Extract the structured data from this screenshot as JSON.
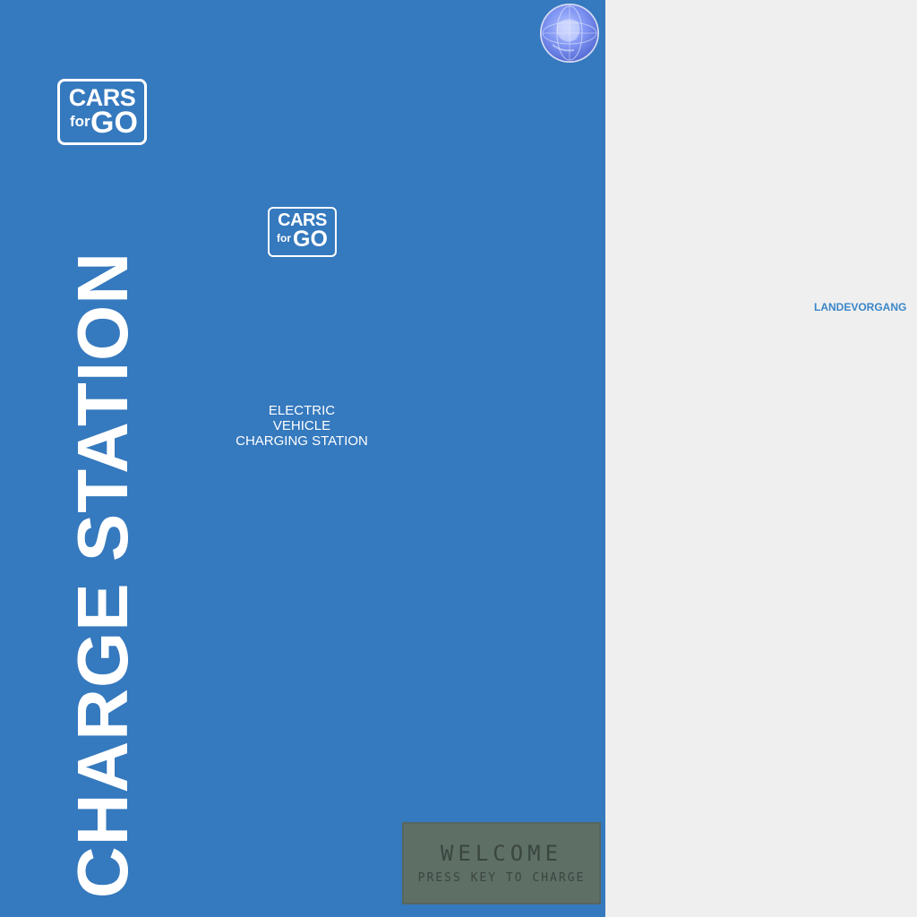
{
  "brand": {
    "logo_top": "CARS",
    "logo_for": "for",
    "logo_go": "GO"
  },
  "station": {
    "vertical_title": "CHARGE STATION",
    "subtitle_lines": [
      "ELECTRIC",
      "VEHICLE",
      "CHARGING STATION"
    ]
  },
  "display": {
    "line1": "WELCOME",
    "line2": "PRESS KEY TO CHARGE"
  },
  "status": {
    "label": "LANDEVORGANG"
  },
  "icons": {
    "globe": "globe-icon"
  },
  "colors": {
    "panel": "#3579be",
    "background": "#efefef",
    "lcd": "#5e6f66",
    "status_text": "#3a86c8"
  }
}
